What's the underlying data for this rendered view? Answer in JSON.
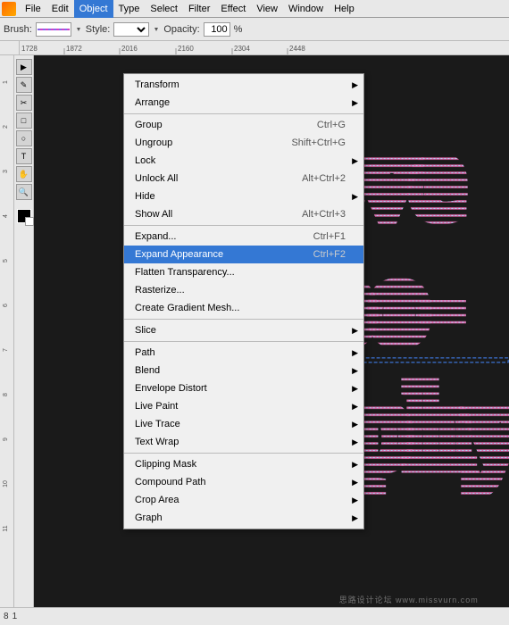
{
  "menubar": {
    "items": [
      "File",
      "Edit",
      "Object",
      "Type",
      "Select",
      "Filter",
      "Effect",
      "View",
      "Window",
      "Help"
    ]
  },
  "toolbar": {
    "brush_label": "Brush:",
    "style_label": "Style:",
    "opacity_label": "Opacity:",
    "opacity_value": "100",
    "opacity_unit": "%"
  },
  "dropdown": {
    "title": "Object",
    "items": [
      {
        "label": "Transform",
        "shortcut": "",
        "arrow": true,
        "separator_after": false,
        "disabled": false,
        "highlighted": false
      },
      {
        "label": "Arrange",
        "shortcut": "",
        "arrow": true,
        "separator_after": true,
        "disabled": false,
        "highlighted": false
      },
      {
        "label": "Group",
        "shortcut": "Ctrl+G",
        "arrow": false,
        "separator_after": false,
        "disabled": false,
        "highlighted": false
      },
      {
        "label": "Ungroup",
        "shortcut": "Shift+Ctrl+G",
        "arrow": false,
        "separator_after": false,
        "disabled": false,
        "highlighted": false
      },
      {
        "label": "Lock",
        "shortcut": "",
        "arrow": true,
        "separator_after": false,
        "disabled": false,
        "highlighted": false
      },
      {
        "label": "Unlock All",
        "shortcut": "Alt+Ctrl+2",
        "arrow": false,
        "separator_after": false,
        "disabled": false,
        "highlighted": false
      },
      {
        "label": "Hide",
        "shortcut": "",
        "arrow": true,
        "separator_after": false,
        "disabled": false,
        "highlighted": false
      },
      {
        "label": "Show All",
        "shortcut": "Alt+Ctrl+3",
        "arrow": false,
        "separator_after": true,
        "disabled": false,
        "highlighted": false
      },
      {
        "label": "Expand...",
        "shortcut": "Ctrl+F1",
        "arrow": false,
        "separator_after": false,
        "disabled": false,
        "highlighted": false
      },
      {
        "label": "Expand Appearance",
        "shortcut": "Ctrl+F2",
        "arrow": false,
        "separator_after": false,
        "disabled": false,
        "highlighted": true
      },
      {
        "label": "Flatten Transparency...",
        "shortcut": "",
        "arrow": false,
        "separator_after": false,
        "disabled": false,
        "highlighted": false
      },
      {
        "label": "Rasterize...",
        "shortcut": "",
        "arrow": false,
        "separator_after": false,
        "disabled": false,
        "highlighted": false
      },
      {
        "label": "Create Gradient Mesh...",
        "shortcut": "",
        "arrow": false,
        "separator_after": true,
        "disabled": false,
        "highlighted": false
      },
      {
        "label": "Slice",
        "shortcut": "",
        "arrow": true,
        "separator_after": true,
        "disabled": false,
        "highlighted": false
      },
      {
        "label": "Path",
        "shortcut": "",
        "arrow": true,
        "separator_after": false,
        "disabled": false,
        "highlighted": false
      },
      {
        "label": "Blend",
        "shortcut": "",
        "arrow": true,
        "separator_after": false,
        "disabled": false,
        "highlighted": false
      },
      {
        "label": "Envelope Distort",
        "shortcut": "",
        "arrow": true,
        "separator_after": false,
        "disabled": false,
        "highlighted": false
      },
      {
        "label": "Live Paint",
        "shortcut": "",
        "arrow": true,
        "separator_after": false,
        "disabled": false,
        "highlighted": false
      },
      {
        "label": "Live Trace",
        "shortcut": "",
        "arrow": true,
        "separator_after": false,
        "disabled": false,
        "highlighted": false
      },
      {
        "label": "Text Wrap",
        "shortcut": "",
        "arrow": true,
        "separator_after": true,
        "disabled": false,
        "highlighted": false
      },
      {
        "label": "Clipping Mask",
        "shortcut": "",
        "arrow": true,
        "separator_after": false,
        "disabled": false,
        "highlighted": false
      },
      {
        "label": "Compound Path",
        "shortcut": "",
        "arrow": true,
        "separator_after": false,
        "disabled": false,
        "highlighted": false
      },
      {
        "label": "Crop Area",
        "shortcut": "",
        "arrow": true,
        "separator_after": false,
        "disabled": false,
        "highlighted": false
      },
      {
        "label": "Graph",
        "shortcut": "",
        "arrow": true,
        "separator_after": false,
        "disabled": false,
        "highlighted": false
      }
    ]
  },
  "ruler": {
    "h_marks": [
      "1728",
      "1872",
      "2016",
      "2160",
      "2304",
      "2448"
    ]
  },
  "canvas": {
    "watermark": "思路设计论坛  www.missvurn.com"
  },
  "statusbar": {
    "zoom": "8",
    "page": "1"
  },
  "toolbox": {
    "tools": [
      "▶",
      "✎",
      "✂",
      "⬚",
      "⬭",
      "T",
      "✋",
      "🔍"
    ]
  }
}
